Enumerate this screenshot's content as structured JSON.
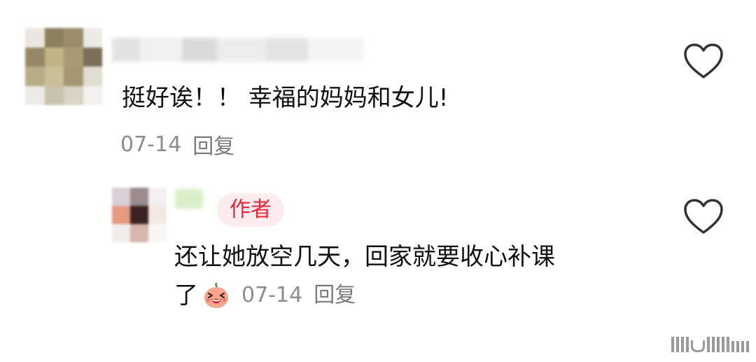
{
  "comment": {
    "text": "挺好诶！！ 幸福的妈妈和女儿!",
    "date": "07-14",
    "reply_label": "回复",
    "like_icon": "heart-outline-icon"
  },
  "reply": {
    "author_badge": "作者",
    "text_line1": "还让她放空几天，回家就要收心补课",
    "text_line2": "了",
    "emoji_icon": "laughing-face-emoji-icon",
    "date": "07-14",
    "reply_label": "回复",
    "like_icon": "heart-outline-icon"
  },
  "colors": {
    "text": "#111111",
    "meta": "#8c8c8c",
    "author_badge_text": "#e8253a",
    "author_badge_bg": "#fdecee",
    "like_stroke": "#333333"
  }
}
